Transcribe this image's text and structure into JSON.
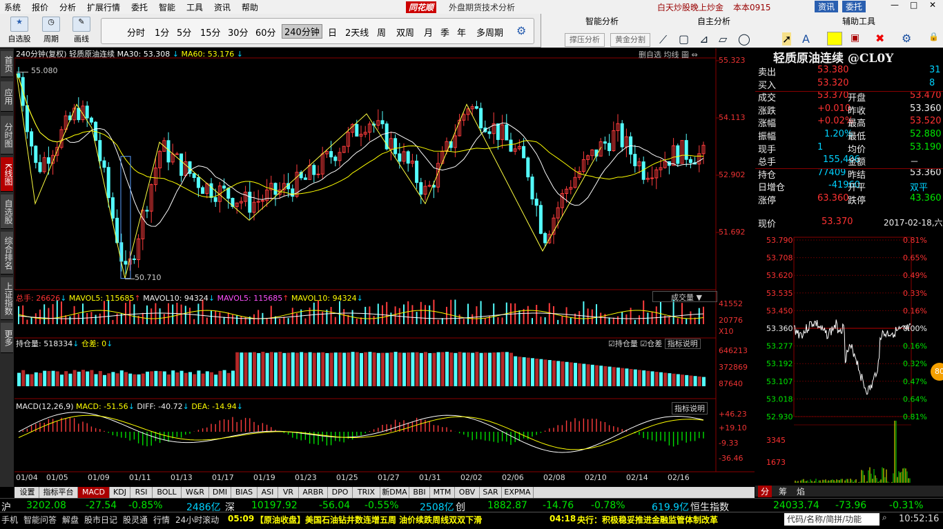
{
  "menu": {
    "items": [
      "系统",
      "报价",
      "分析",
      "扩展行情",
      "委托",
      "智能",
      "工具",
      "资讯",
      "帮助"
    ],
    "brand": "同花顺",
    "subtitle": "外盘期货技术分析",
    "promo": "白天炒股晚上炒金",
    "edition": "本本0915",
    "news_btn": "资讯",
    "trade_btn": "委托"
  },
  "toolbar": {
    "btn1": "自选股",
    "btn2": "周期",
    "btn3": "画线",
    "periods": [
      "分时",
      "1分",
      "5分",
      "15分",
      "30分",
      "60分",
      "240分钟",
      "日",
      "2天线",
      "周",
      "双周",
      "月",
      "季",
      "年",
      "多周期"
    ],
    "selected_period": "240分钟",
    "smart_title": "智能分析",
    "self_title": "自主分析",
    "aux_title": "辅助工具",
    "pressure_btn": "撑压分析",
    "golden_btn": "黄金分割"
  },
  "left_tabs": [
    "首页",
    "应用",
    "分时图",
    "K线图",
    "自选股",
    "综合排名",
    "上证指数",
    "更多"
  ],
  "chart": {
    "header": "240分钟(复权) 轻质原油连续",
    "ma30": "MA30: 53.308",
    "ma60": "MA60: 53.176",
    "overlay": "删自选 均线 圖 ⇔",
    "high_label": "55.080",
    "low_label": "50.710",
    "yticks": [
      "55.323",
      "54.113",
      "52.902",
      "51.692"
    ],
    "vol_header": "总手: 26626",
    "mavol5": "MAVOL5: 115685",
    "mavol10": "MAVOL10: 94324",
    "mavol5b": "MAVOL5: 115685",
    "mavol10b": "MAVOL10: 94324",
    "vol_select": "成交量",
    "vol_ticks": [
      "41552",
      "20776",
      "X10"
    ],
    "oi_header": "持仓量: 518334",
    "oi_diff": "仓差: 0",
    "oi_chk1": "持仓量",
    "oi_chk2": "仓差",
    "oi_btn": "指标说明",
    "oi_ticks": [
      "646213",
      "372869",
      "87640"
    ],
    "macd_header": "MACD(12,26,9)",
    "macd_val": "MACD: -51.56",
    "diff_val": "DIFF: -40.72",
    "dea_val": "DEA: -14.94",
    "macd_btn": "指标说明",
    "macd_ticks": [
      "+46.23",
      "+19.10",
      "-9.33",
      "-36.46"
    ],
    "dates": [
      "01/04",
      "01/05",
      "01/09",
      "01/11",
      "01/13",
      "01/17",
      "01/19",
      "01/23",
      "01/25",
      "01/27",
      "01/31",
      "02/02",
      "02/06",
      "02/08",
      "02/10",
      "02/14",
      "02/16"
    ]
  },
  "quote": {
    "title": "轻质原油连续 @CL0Y",
    "rows": [
      [
        "卖出",
        "53.380",
        "",
        "",
        "31"
      ],
      [
        "买入",
        "53.320",
        "",
        "",
        "8"
      ],
      [
        "成交",
        "53.370",
        "开盘",
        "53.470",
        ""
      ],
      [
        "涨跌",
        "+0.010",
        "昨收",
        "53.360",
        ""
      ],
      [
        "涨幅",
        "+0.02%",
        "最高",
        "53.520",
        ""
      ],
      [
        "振幅",
        "1.20%",
        "最低",
        "52.880",
        ""
      ],
      [
        "现手",
        "1",
        "均价",
        "53.190",
        ""
      ],
      [
        "总手",
        "155,406",
        "金额",
        "－",
        ""
      ],
      [
        "持仓",
        "77409",
        "昨结",
        "53.360",
        ""
      ],
      [
        "日增仓",
        "-41960",
        "开平",
        "双平",
        ""
      ],
      [
        "涨停",
        "63.360",
        "跌停",
        "43.360",
        ""
      ]
    ],
    "now_label": "现价",
    "now_val": "53.370",
    "date": "2017-02-18,六",
    "mini_left": [
      "53.790",
      "53.708",
      "53.620",
      "53.535",
      "53.450",
      "53.360",
      "53.277",
      "53.192",
      "53.107",
      "53.018",
      "52.930"
    ],
    "mini_right": [
      "0.81%",
      "0.65%",
      "0.49%",
      "0.33%",
      "0.16%",
      "0.00%",
      "0.16%",
      "0.32%",
      "0.47%",
      "0.64%",
      "0.81%"
    ],
    "mini_vol": [
      "3345",
      "1673"
    ],
    "bottom_tabs": [
      "分",
      "筹",
      "焰"
    ],
    "badge": "80"
  },
  "indicators": [
    "设置",
    "指标平台",
    "MACD",
    "KDJ",
    "RSI",
    "BOLL",
    "W&R",
    "DMI",
    "BIAS",
    "ASI",
    "VR",
    "ARBR",
    "DPO",
    "TRIX",
    "新DMA",
    "BBI",
    "MTM",
    "OBV",
    "SAR",
    "EXPMA"
  ],
  "ticker": {
    "sh": "沪",
    "sh_val": "3202.08",
    "sh_chg": "-27.54",
    "sh_pct": "-0.85%",
    "sh_amt": "2486亿",
    "sz": "深",
    "sz_val": "10197.92",
    "sz_chg": "-56.04",
    "sz_pct": "-0.55%",
    "sz_amt": "2508亿",
    "cy": "创",
    "cy_val": "1882.87",
    "cy_chg": "-14.76",
    "cy_pct": "-0.78%",
    "cy_amt": "619.9亿",
    "hs": "恒生指数",
    "hs_val": "24033.74",
    "hs_chg": "-73.96",
    "hs_pct": "-0.31%"
  },
  "status": {
    "items": [
      "手机",
      "智能问答",
      "解盘",
      "股市日记",
      "股灵通",
      "行情",
      "24小时滚动"
    ],
    "news1_time": "05:09",
    "news1": "【原油收盘】美国石油钻井数连增五周 油价续跌周线双双下滑",
    "news2_time": "04:18",
    "news2": "央行：积极稳妥推进金融监管体制改革",
    "search": "代码/名称/简拼/功能",
    "clock": "10:52:16"
  }
}
